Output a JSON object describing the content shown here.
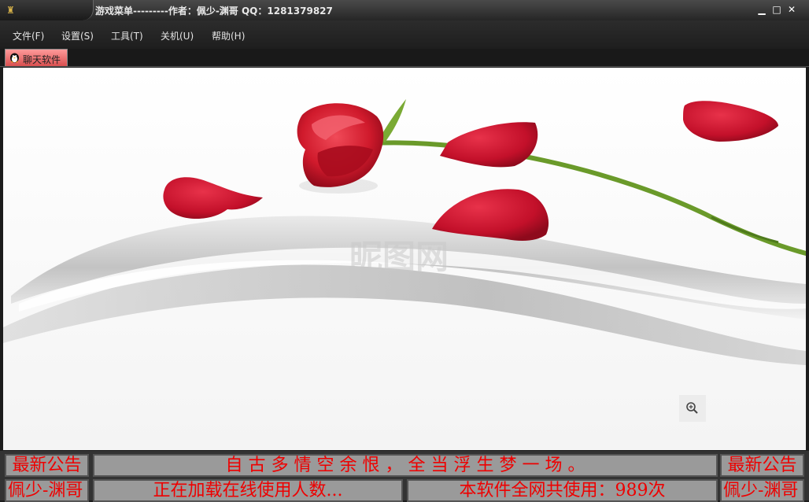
{
  "window": {
    "title": "游戏菜单---------作者：佩少-渊哥 QQ：1281379827",
    "controls": {
      "minimize": "▁",
      "maximize": "□",
      "close": "✕"
    }
  },
  "menu": [
    {
      "label": "文件(F)"
    },
    {
      "label": "设置(S)"
    },
    {
      "label": "工具(T)"
    },
    {
      "label": "关机(U)"
    },
    {
      "label": "帮助(H)"
    }
  ],
  "tab": {
    "label": "聊天软件",
    "icon": "penguin-icon"
  },
  "content": {
    "watermark": "昵图网",
    "zoom_icon": "magnifier-icon"
  },
  "bottom": {
    "row1": {
      "left": "最新公告",
      "marquee": "自 古 多 情 空 余 恨 ， 全 当 浮 生 梦 一 场 。",
      "right": "最新公告"
    },
    "row2": {
      "left": "佩少-渊哥",
      "loading": "正在加载在线使用人数...",
      "usage": "本软件全网共使用：989次",
      "right": "佩少-渊哥"
    }
  },
  "colors": {
    "accent_red": "#e00000",
    "rose": "#c8102e",
    "stem": "#6a9a2a",
    "tab": "#e86a6a"
  }
}
